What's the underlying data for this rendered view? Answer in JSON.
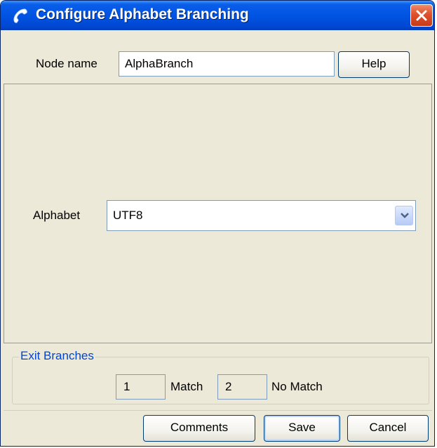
{
  "window": {
    "title": "Configure Alphabet Branching"
  },
  "node": {
    "label": "Node name",
    "value": "AlphaBranch"
  },
  "help_label": "Help",
  "alphabet": {
    "label": "Alphabet",
    "selected": "UTF8"
  },
  "exit_branches": {
    "title": "Exit Branches",
    "items": [
      {
        "number": "1",
        "label": "Match"
      },
      {
        "number": "2",
        "label": "No Match"
      }
    ]
  },
  "footer": {
    "comments_label": "Comments",
    "save_label": "Save",
    "cancel_label": "Cancel"
  },
  "icons": {
    "title": "phone-handset-icon",
    "close": "close-icon",
    "dropdown": "chevron-down-icon"
  },
  "colors": {
    "title_bar": "#0054e3",
    "dialog_bg": "#ece9d8",
    "close_button": "#e0502c",
    "group_title": "#0046d5"
  }
}
